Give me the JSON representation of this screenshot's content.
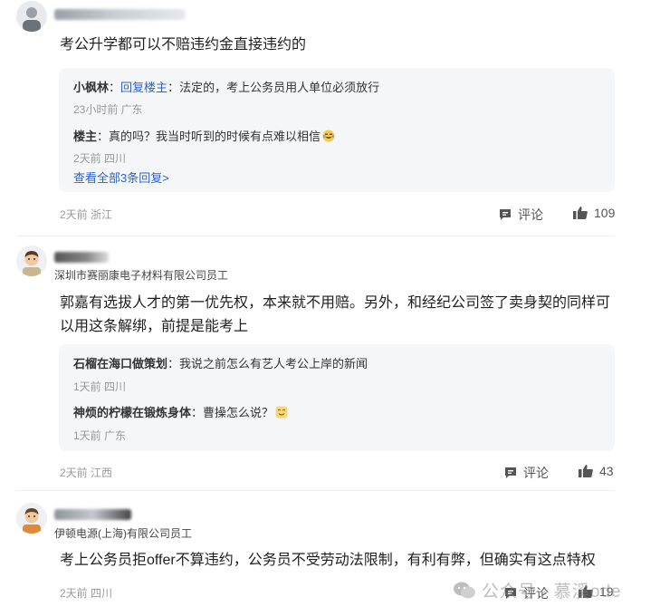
{
  "comments": [
    {
      "text": "考公升学都可以不赔违约金直接违约的",
      "replies": [
        {
          "name": "小枫林",
          "link": "回复楼主",
          "text": "法定的，考上公务员用人单位必须放行",
          "meta": "23小时前 广东"
        },
        {
          "name": "楼主",
          "text": "真的吗？我当时听到的时候有点难以相信",
          "meta": "2天前 四川"
        }
      ],
      "view_all": "查看全部3条回复>",
      "meta": "2天前 浙江",
      "comment_label": "评论",
      "likes": "109"
    },
    {
      "company": "深圳市赛丽康电子材料有限公司员工",
      "text_line1": "郭嘉有选拔人才的第一优先权，本来就不用赔。另外，和经纪公司签了卖身契的同样可",
      "text_line2": "以用这条解绑，前提是能考上",
      "replies": [
        {
          "name": "石榴在海口做策划",
          "text": "我说之前怎么有艺人考公上岸的新闻",
          "meta": "1天前 四川"
        },
        {
          "name": "神烦的柠檬在锻炼身体",
          "text": "曹操怎么说？",
          "meta": "1天前 广东"
        }
      ],
      "meta": "2天前 江西",
      "comment_label": "评论",
      "likes": "43"
    },
    {
      "company": "伊顿电源(上海)有限公司员工",
      "text": "考上公务员拒offer不算违约，公务员不受劳动法限制，有利有弊，但确实有这点特权",
      "meta": "2天前 四川",
      "comment_label": "评论",
      "likes": "19"
    }
  ],
  "watermark": "公众号 · 慕溪ode",
  "colors": {
    "link": "#2a62d6",
    "meta": "#9a9a9a",
    "reply_bg": "#f5f6f8"
  }
}
